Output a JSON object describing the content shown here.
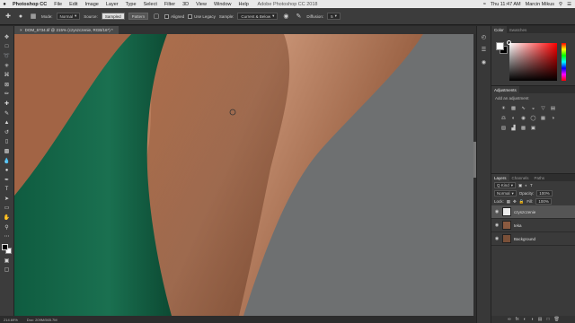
{
  "menubar": {
    "app": "Photoshop CC",
    "menus": [
      "File",
      "Edit",
      "Image",
      "Layer",
      "Type",
      "Select",
      "Filter",
      "3D",
      "View",
      "Window",
      "Help"
    ],
    "window_title": "Adobe Photoshop CC 2018",
    "time": "Thu 11:47 AM",
    "user": "Marcin Mikus"
  },
  "options": {
    "mode_label": "Mode:",
    "mode_value": "Normal",
    "source_label": "Source:",
    "sampled": "Sampled",
    "pattern": "Pattern",
    "aligned": "Aligned",
    "use_legacy": "Use Legacy",
    "sample_label": "Sample:",
    "sample_value": "Current & Below",
    "diffusion_label": "Diffusion:",
    "diffusion_value": "5"
  },
  "document": {
    "tab_title": "DOM_6734.tif @ 215% (czyszczenie, RGB/16*) *"
  },
  "statusbar": {
    "zoom": "214.69%",
    "doc": "Doc: 209M/565.7M"
  },
  "panels": {
    "color_tab": "Color",
    "swatches_tab": "Swatches",
    "adjustments_tab": "Adjustments",
    "adjustments_hint": "Add an adjustment",
    "layers_tab": "Layers",
    "channels_tab": "Channels",
    "paths_tab": "Paths",
    "kind_filter": "Q Kind",
    "blend_mode": "Normal",
    "opacity_label": "Opacity:",
    "opacity_value": "100%",
    "lock_label": "Lock:",
    "fill_label": "Fill:",
    "fill_value": "100%"
  },
  "layers": [
    {
      "name": "czyszczenie",
      "active": true
    },
    {
      "name": "teka",
      "active": false
    },
    {
      "name": "Background",
      "active": false
    }
  ],
  "colors": {
    "accent_hue": "#ff0000",
    "panel_bg": "#3a3a3a",
    "swimsuit": "#1a6e4e",
    "skin": "#a8694a",
    "backdrop": "#6e7071"
  }
}
